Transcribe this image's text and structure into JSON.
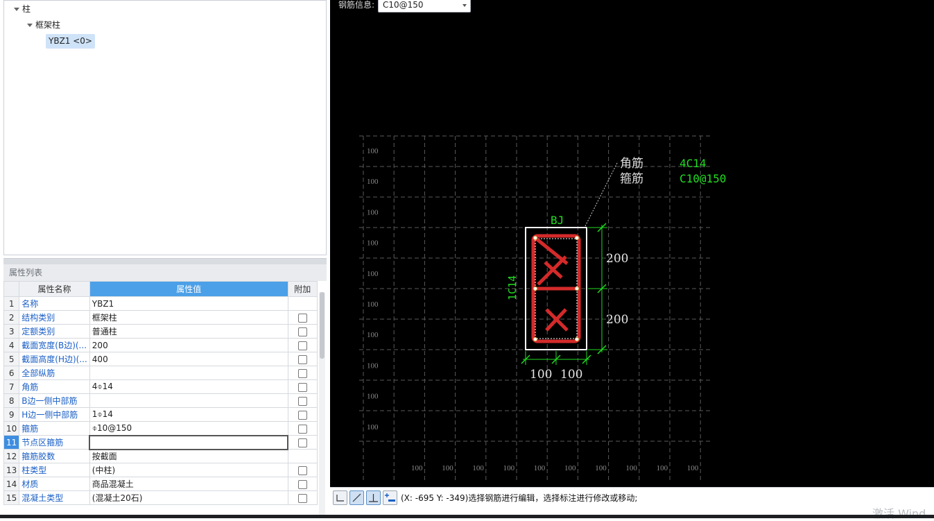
{
  "tree": {
    "root_label": "柱",
    "group_label": "框架柱",
    "item_label": "YBZ1 <0>"
  },
  "properties": {
    "title": "属性列表",
    "headers": {
      "name": "属性名称",
      "value": "属性值",
      "extra": "附加"
    },
    "rows": [
      {
        "no": "1",
        "name": "名称",
        "value": "YBZ1",
        "checkbox": false
      },
      {
        "no": "2",
        "name": "结构类别",
        "value": "框架柱",
        "checkbox": true
      },
      {
        "no": "3",
        "name": "定额类别",
        "value": "普通柱",
        "checkbox": true
      },
      {
        "no": "4",
        "name": "截面宽度(B边)(...",
        "value": "200",
        "checkbox": true
      },
      {
        "no": "5",
        "name": "截面高度(H边)(...",
        "value": "400",
        "checkbox": true
      },
      {
        "no": "6",
        "name": "全部纵筋",
        "value": "",
        "checkbox": true
      },
      {
        "no": "7",
        "name": "角筋",
        "value": "4⌽14",
        "checkbox": true
      },
      {
        "no": "8",
        "name": "B边一侧中部筋",
        "value": "",
        "checkbox": true
      },
      {
        "no": "9",
        "name": "H边一侧中部筋",
        "value": "1⌽14",
        "checkbox": true
      },
      {
        "no": "10",
        "name": "箍筋",
        "value": "⌽10@150",
        "checkbox": true
      },
      {
        "no": "11",
        "name": "节点区箍筋",
        "value": "",
        "checkbox": true,
        "selected": true
      },
      {
        "no": "12",
        "name": "箍筋胶数",
        "value": "按截面",
        "checkbox": false
      },
      {
        "no": "13",
        "name": "柱类型",
        "value": "(中柱)",
        "checkbox": true
      },
      {
        "no": "14",
        "name": "材质",
        "value": "商品混凝土",
        "checkbox": true
      },
      {
        "no": "15",
        "name": "混凝土类型",
        "value": "(混凝土20石)",
        "checkbox": true
      }
    ]
  },
  "canvas": {
    "rebar_info_label": "钢筋信息:",
    "rebar_info_value": "C10@150",
    "grid_label": "100",
    "section_name": "BJ",
    "corner_bar_label": "角筋",
    "corner_bar_value": "4C14",
    "stirrup_label": "箍筋",
    "stirrup_value": "C10@150",
    "side_bar_label": "1C14",
    "dim_upper": "200",
    "dim_lower": "200",
    "dim_left": "100",
    "dim_right": "100"
  },
  "status": {
    "text": "(X: -695 Y: -349)选择钢筋进行编辑，选择标注进行修改或移动;",
    "watermark": "激活 Wind"
  },
  "colors": {
    "canvas_bg": "#000000",
    "rebar_red": "#d42a2a",
    "annotation_green": "#22dd22",
    "grid_gray": "#5a5a5a",
    "header_blue": "#4ca0e8",
    "link_blue": "#1a5fc6"
  }
}
